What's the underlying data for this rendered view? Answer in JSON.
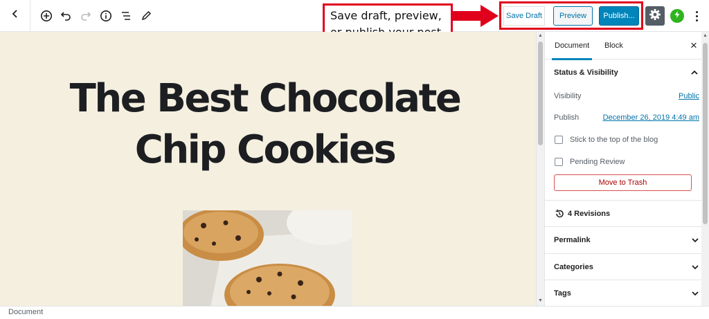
{
  "toolbar": {
    "save_draft_label": "Save Draft",
    "preview_label": "Preview",
    "publish_label": "Publish...",
    "icons": [
      "back-arrow-icon",
      "add-block-icon",
      "undo-icon",
      "redo-icon",
      "info-icon",
      "block-navigation-icon",
      "edit-tools-icon",
      "gear-icon",
      "jetpack-icon",
      "more-options-icon"
    ],
    "accent_color": "#0085ba"
  },
  "annotation": {
    "text": "Save draft, preview, or publish your post",
    "color": "#e0001b"
  },
  "post": {
    "title": "The Best Chocolate Chip Cookies",
    "background_color": "#f5efe0"
  },
  "sidebar": {
    "tabs": [
      {
        "label": "Document",
        "active": true
      },
      {
        "label": "Block",
        "active": false
      }
    ],
    "status_visibility": {
      "heading": "Status & Visibility",
      "visibility_label": "Visibility",
      "visibility_value": "Public",
      "publish_label": "Publish",
      "publish_value": "December 26, 2019 4:49 am",
      "sticky_label": "Stick to the top of the blog",
      "pending_label": "Pending Review",
      "trash_label": "Move to Trash"
    },
    "revisions_label": "4 Revisions",
    "panels": [
      "Permalink",
      "Categories",
      "Tags"
    ]
  },
  "footer": {
    "breadcrumb": "Document"
  }
}
